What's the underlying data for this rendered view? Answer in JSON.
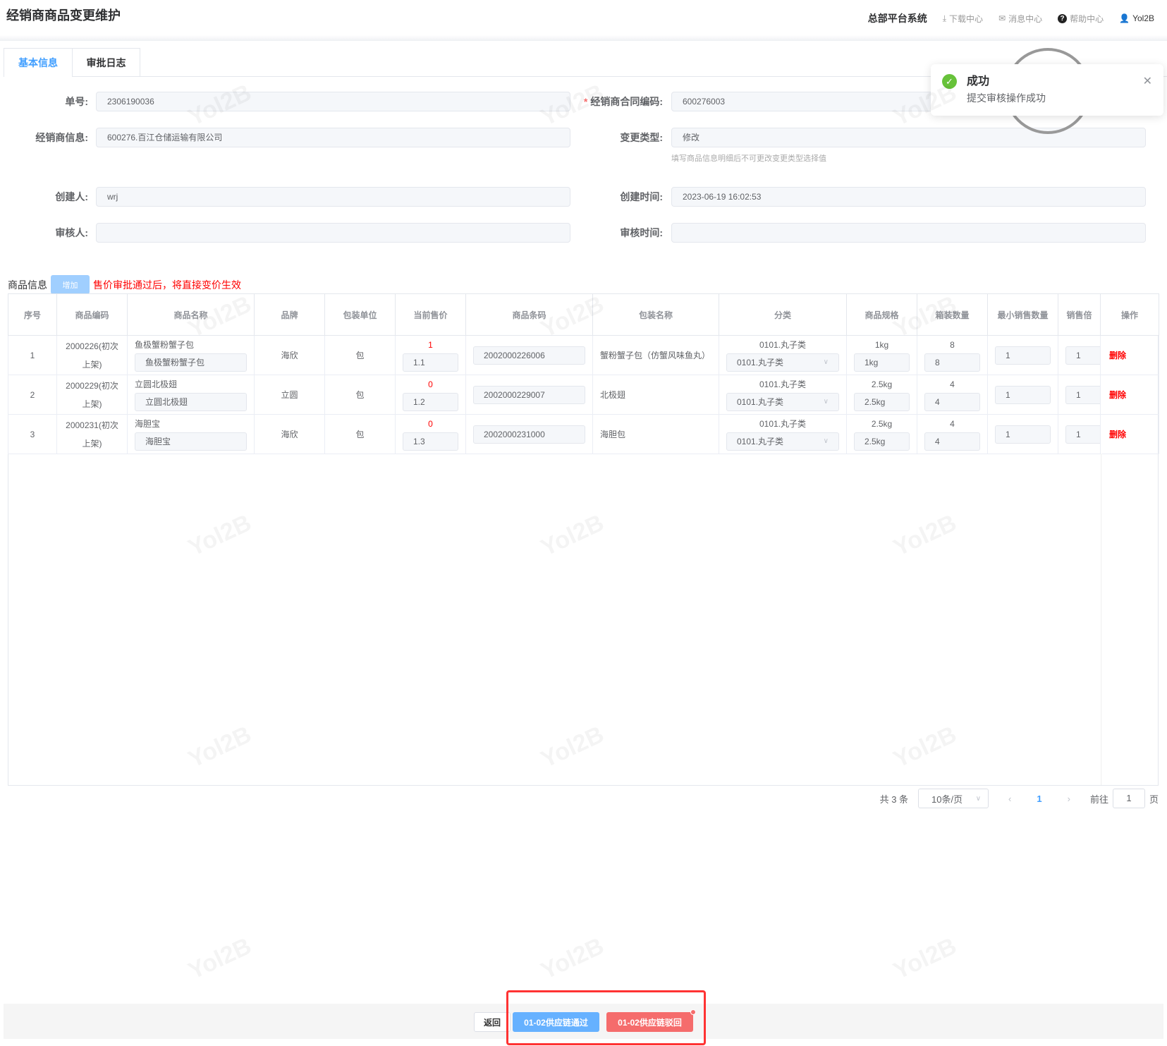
{
  "header": {
    "title": "经销商商品变更维护",
    "system": "总部平台系统",
    "download": "下载中心",
    "messages": "消息中心",
    "help": "帮助中心",
    "user": "Yol2B"
  },
  "tabs": [
    {
      "label": "基本信息"
    },
    {
      "label": "审批日志"
    }
  ],
  "form": {
    "order_no": {
      "label": "单号:",
      "value": "2306190036"
    },
    "contract_code": {
      "label": "经销商合同编码:",
      "value": "600276003",
      "required": "*"
    },
    "dealer_info": {
      "label": "经销商信息:",
      "value": "600276.百江仓储运输有限公司"
    },
    "change_type": {
      "label": "变更类型:",
      "value": "修改",
      "hint": "填写商品信息明细后不可更改变更类型选择值"
    },
    "creator": {
      "label": "创建人:",
      "value": "wrj"
    },
    "create_time": {
      "label": "创建时间:",
      "value": "2023-06-19 16:02:53"
    },
    "reviewer": {
      "label": "审核人:",
      "value": ""
    },
    "review_time": {
      "label": "审核时间:",
      "value": ""
    }
  },
  "section": {
    "title": "商品信息",
    "add": "增加",
    "warning": "售价审批通过后，将直接变价生效"
  },
  "table": {
    "columns": [
      "序号",
      "商品编码",
      "商品名称",
      "品牌",
      "包装单位",
      "当前售价",
      "商品条码",
      "包装名称",
      "分类",
      "商品规格",
      "箱装数量",
      "最小销售数量",
      "销售倍",
      "操作"
    ],
    "rows": [
      {
        "no": "1",
        "code": "2000226(初次上架)",
        "name": "鱼极蟹粉蟹子包",
        "name_input": "鱼极蟹粉蟹子包",
        "brand": "海欣",
        "unit": "包",
        "price_old": "1",
        "price": "1.1",
        "barcode": "2002000226006",
        "pack_name": "蟹粉蟹子包（仿蟹风味鱼丸）",
        "category": "0101.丸子类",
        "category_sel": "0101.丸子类",
        "spec": "1kg",
        "spec_input": "1kg",
        "box_qty": "8",
        "box_input": "8",
        "min_qty": "1",
        "multiple": "1",
        "action": "删除"
      },
      {
        "no": "2",
        "code": "2000229(初次上架)",
        "name": "立圆北极翅",
        "name_input": "立圆北极翅",
        "brand": "立圆",
        "unit": "包",
        "price_old": "0",
        "price": "1.2",
        "barcode": "2002000229007",
        "pack_name": "北极翅",
        "category": "0101.丸子类",
        "category_sel": "0101.丸子类",
        "spec": "2.5kg",
        "spec_input": "2.5kg",
        "box_qty": "4",
        "box_input": "4",
        "min_qty": "1",
        "multiple": "1",
        "action": "删除"
      },
      {
        "no": "3",
        "code": "2000231(初次上架)",
        "name": "海胆宝",
        "name_input": "海胆宝",
        "brand": "海欣",
        "unit": "包",
        "price_old": "0",
        "price": "1.3",
        "barcode": "2002000231000",
        "pack_name": "海胆包",
        "category": "0101.丸子类",
        "category_sel": "0101.丸子类",
        "spec": "2.5kg",
        "spec_input": "2.5kg",
        "box_qty": "4",
        "box_input": "4",
        "min_qty": "1",
        "multiple": "1",
        "action": "删除"
      }
    ]
  },
  "pagination": {
    "total": "共 3 条",
    "page_size": "10条/页",
    "current": "1",
    "goto": "前往",
    "goto_value": "1",
    "page_suffix": "页"
  },
  "footer": {
    "back": "返回",
    "approve": "01-02供应链通过",
    "reject": "01-02供应链驳回"
  },
  "toast": {
    "title": "成功",
    "message": "提交审核操作成功"
  },
  "watermark": "Yol2B",
  "colors": {
    "primary": "#409eff",
    "danger": "#f56c6c",
    "success": "#67c23a"
  }
}
